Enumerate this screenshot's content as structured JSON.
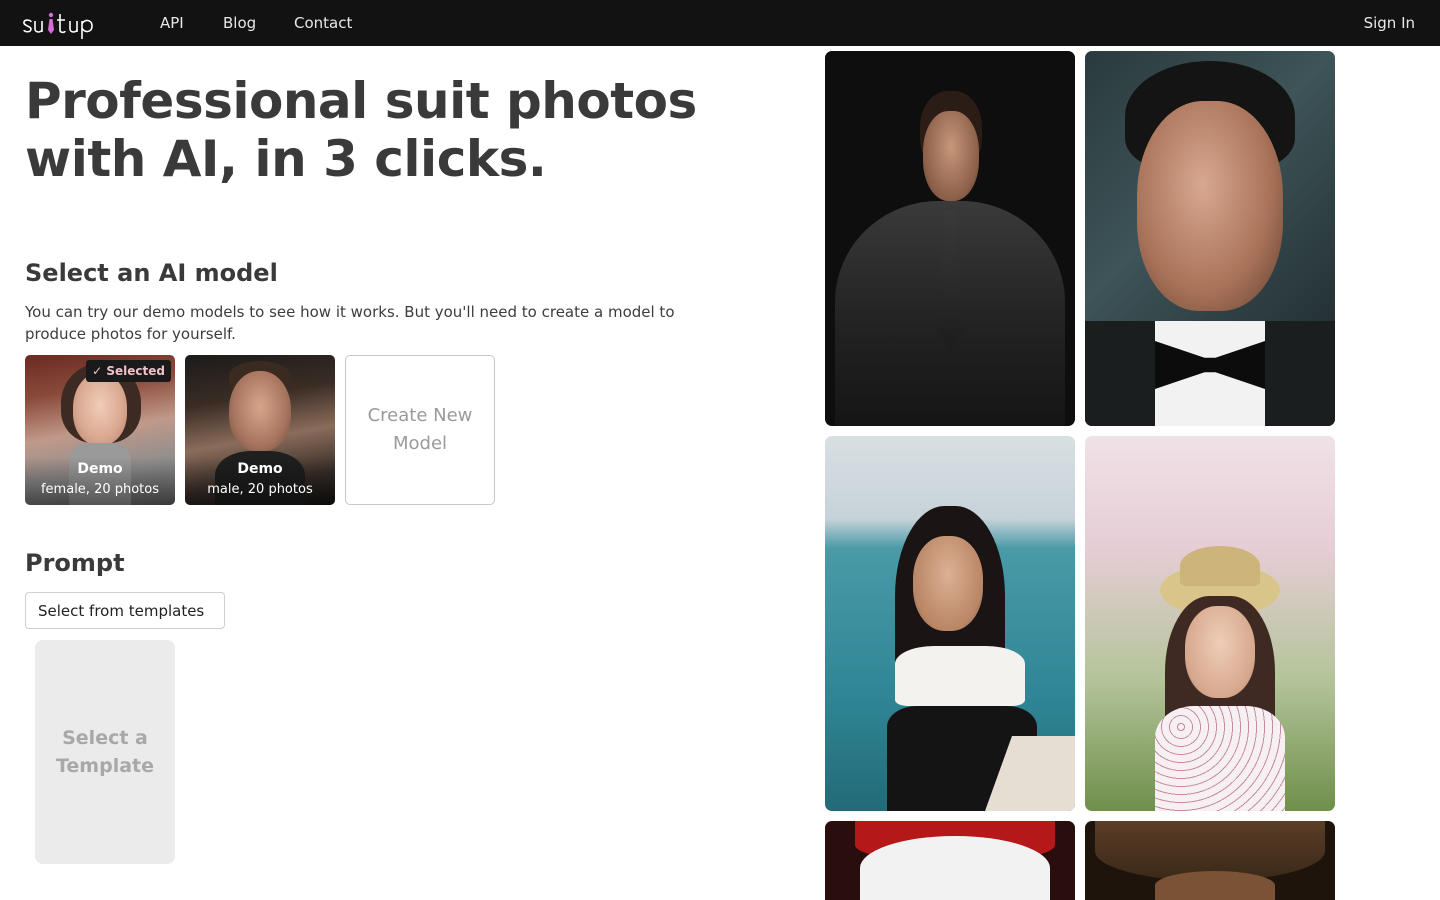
{
  "nav": {
    "logo_alt": "suitup",
    "links": [
      "API",
      "Blog",
      "Contact"
    ],
    "sign_in": "Sign In"
  },
  "hero": {
    "title_line1": "Professional suit photos",
    "title_line2": "with AI, in 3 clicks."
  },
  "model_section": {
    "title": "Select an AI model",
    "description": "You can try our demo models to see how it works. But you'll need to create a model to produce photos for yourself.",
    "models": [
      {
        "name": "Demo",
        "subtitle": "female, 20 photos",
        "selected": true,
        "badge": "✓ Selected"
      },
      {
        "name": "Demo",
        "subtitle": "male, 20 photos",
        "selected": false
      }
    ],
    "create_label": "Create New Model"
  },
  "prompt_section": {
    "title": "Prompt",
    "select_label": "Select from templates",
    "template_placeholder": "Select a Template"
  },
  "colors": {
    "navbar_bg": "#121212",
    "logo_accent": "#d76cd6",
    "badge_text": "#f0c0c8"
  }
}
